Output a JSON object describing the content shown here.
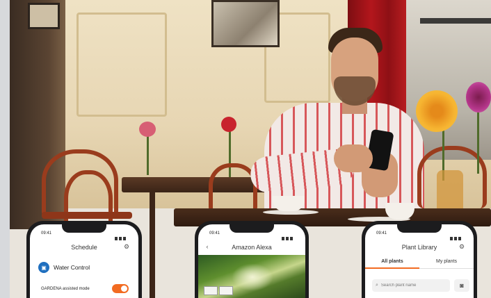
{
  "photo": {
    "subject": "man-with-smartphone-in-cafe"
  },
  "phones": [
    {
      "time": "09:41",
      "title": "Schedule",
      "header_icon": "gear-icon",
      "section_label": "Water Control",
      "section_icon": "water-control-icon",
      "toggle_label": "GARDENA assisted mode",
      "toggle_on": true
    },
    {
      "time": "09:41",
      "title": "Amazon Alexa",
      "back_icon": "chevron-left-icon",
      "image": "garden-photo",
      "badges": [
        "works with alexa",
        "gardena"
      ]
    },
    {
      "time": "09:41",
      "title": "Plant Library",
      "header_icon": "gear-icon",
      "tabs": [
        "All plants",
        "My plants"
      ],
      "active_tab": 0,
      "search_placeholder": "Search plant name",
      "camera_icon": "camera-icon"
    }
  ],
  "colors": {
    "accent": "#f26b21",
    "water_control_blue": "#1f6fbf"
  }
}
